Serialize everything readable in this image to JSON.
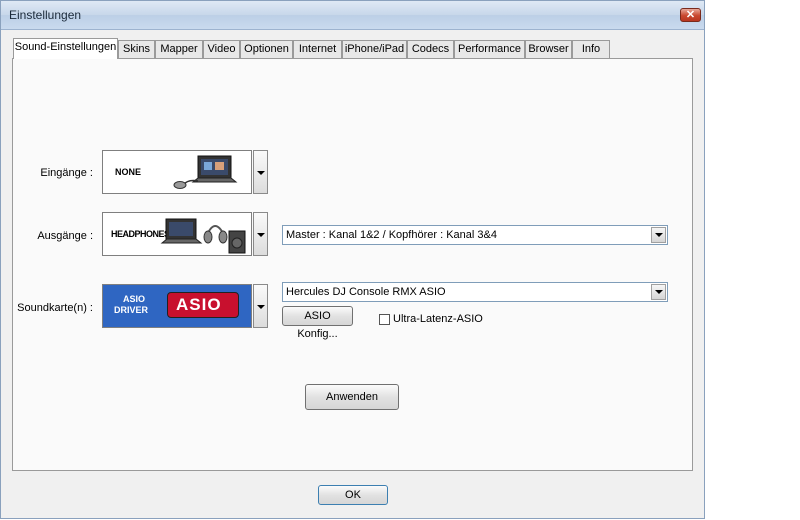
{
  "window": {
    "title": "Einstellungen",
    "close_icon": "close-icon"
  },
  "tabs": [
    {
      "label": "Sound-Einstellungen",
      "active": true
    },
    {
      "label": "Skins"
    },
    {
      "label": "Mapper"
    },
    {
      "label": "Video"
    },
    {
      "label": "Optionen"
    },
    {
      "label": "Internet"
    },
    {
      "label": "iPhone/iPad"
    },
    {
      "label": "Codecs"
    },
    {
      "label": "Performance"
    },
    {
      "label": "Browser"
    },
    {
      "label": "Info"
    }
  ],
  "inputs": {
    "label": "Eingänge :",
    "image_text": "NONE"
  },
  "outputs": {
    "label": "Ausgänge :",
    "image_text": "HEADPHONES",
    "routing_value": "Master : Kanal 1&2 / Kopfhörer : Kanal 3&4"
  },
  "soundcard": {
    "label": "Soundkarte(n) :",
    "image_text_line1": "ASIO",
    "image_text_line2": "DRIVER",
    "image_logo": "ASIO",
    "device_value": "Hercules DJ Console RMX ASIO",
    "config_button": "ASIO Konfig...",
    "ultra_latency_label": "Ultra-Latenz-ASIO",
    "ultra_latency_checked": false
  },
  "apply_button": "Anwenden",
  "ok_button": "OK",
  "colors": {
    "asio_blue": "#2f66c2",
    "asio_red": "#c8102e",
    "title_bg": "#c7d7ea"
  }
}
